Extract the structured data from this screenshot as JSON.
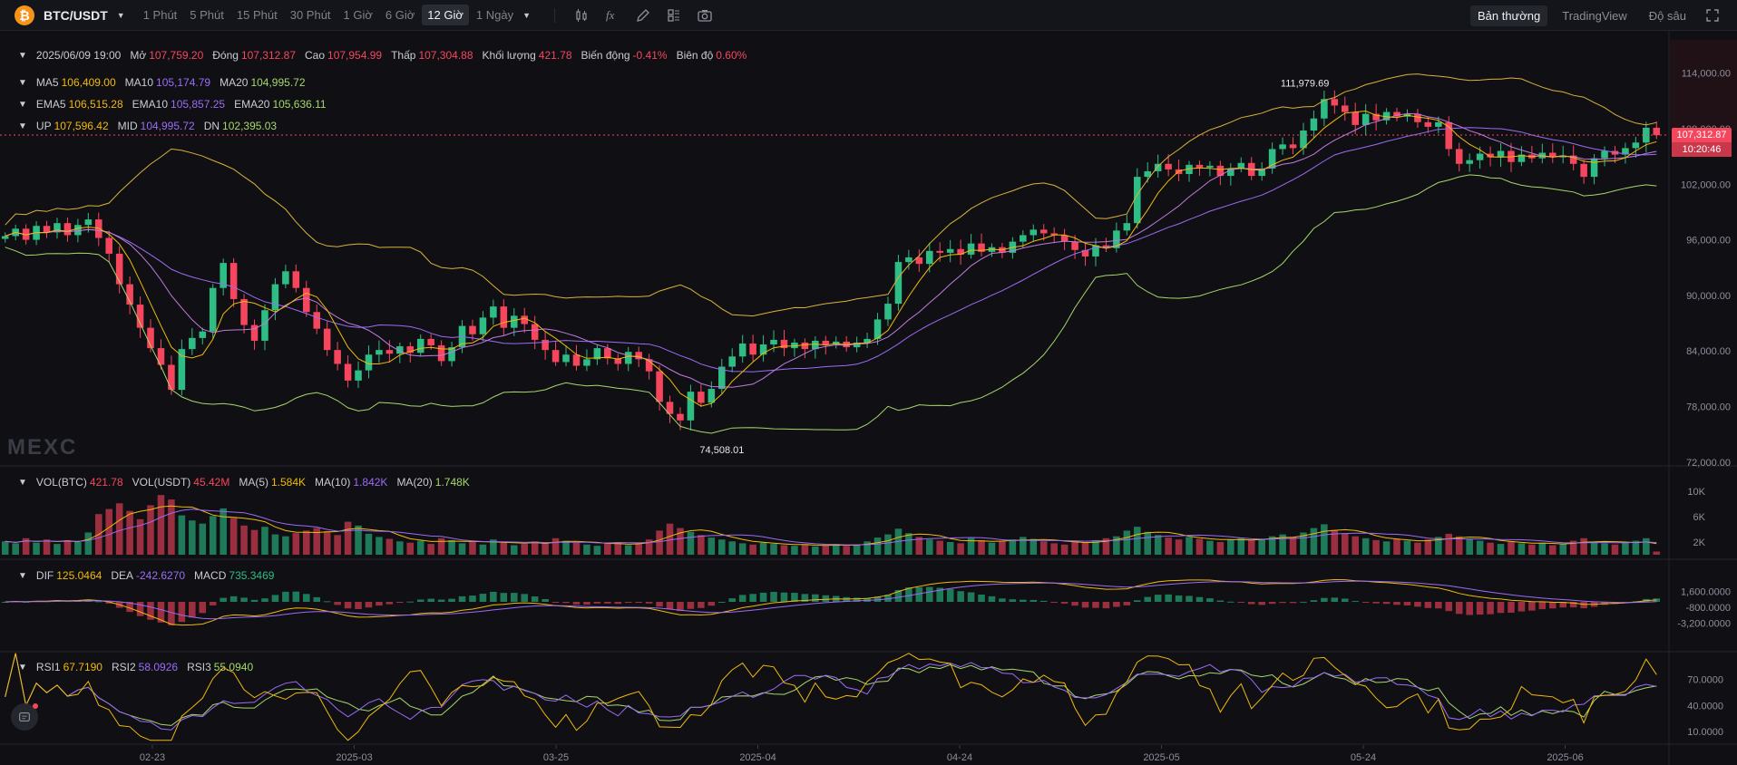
{
  "toolbar": {
    "pair": "BTC/USDT",
    "coin_icon": "bitcoin-icon",
    "intervals": [
      "1 Phút",
      "5 Phút",
      "15 Phút",
      "30 Phút",
      "1 Giờ",
      "6 Giờ",
      "12 Giờ",
      "1 Ngày"
    ],
    "active_interval": "12 Giờ",
    "tools": [
      "candle-type-icon",
      "indicator-fx-icon",
      "draw-pen-icon",
      "layout-grid-icon",
      "camera-icon"
    ],
    "view_tabs": [
      "Bản thường",
      "TradingView",
      "Độ sâu"
    ],
    "active_view": "Bản thường",
    "fullscreen_icon": "fullscreen-icon"
  },
  "ohlc": {
    "date": "2025/06/09 19:00",
    "open_label": "Mở",
    "open": "107,759.20",
    "close_label": "Đóng",
    "close": "107,312.87",
    "high_label": "Cao",
    "high": "107,954.99",
    "low_label": "Thấp",
    "low": "107,304.88",
    "volume_label": "Khối lượng",
    "volume": "421.78",
    "change_label": "Biến động",
    "change": "-0.41%",
    "amplitude_label": "Biên độ",
    "amplitude": "0.60%"
  },
  "ma": {
    "ma5_label": "MA5",
    "ma5": "106,409.00",
    "ma10_label": "MA10",
    "ma10": "105,174.79",
    "ma20_label": "MA20",
    "ma20": "104,995.72"
  },
  "ema": {
    "ema5_label": "EMA5",
    "ema5": "106,515.28",
    "ema10_label": "EMA10",
    "ema10": "105,857.25",
    "ema20_label": "EMA20",
    "ema20": "105,636.11"
  },
  "boll": {
    "up_label": "UP",
    "up": "107,596.42",
    "mid_label": "MID",
    "mid": "104,995.72",
    "dn_label": "DN",
    "dn": "102,395.03"
  },
  "vol": {
    "btc_label": "VOL(BTC)",
    "btc": "421.78",
    "usdt_label": "VOL(USDT)",
    "usdt": "45.42M",
    "ma5_label": "MA(5)",
    "ma5": "1.584K",
    "ma10_label": "MA(10)",
    "ma10": "1.842K",
    "ma20_label": "MA(20)",
    "ma20": "1.748K"
  },
  "macd": {
    "dif_label": "DIF",
    "dif": "125.0464",
    "dea_label": "DEA",
    "dea": "-242.6270",
    "macd_label": "MACD",
    "macd": "735.3469"
  },
  "rsi": {
    "rsi1_label": "RSI1",
    "rsi1": "67.7190",
    "rsi2_label": "RSI2",
    "rsi2": "58.0926",
    "rsi3_label": "RSI3",
    "rsi3": "55.0940"
  },
  "current_price": {
    "price": "107,312.87",
    "countdown": "10:20:46"
  },
  "watermark": "MEXC",
  "colors": {
    "up": "#2ebd85",
    "down": "#f6465d",
    "ma5": "#f0b90b",
    "ma10": "#9b6cf5",
    "ma20": "#a6d76b",
    "boll": "#d9b23a"
  },
  "chart_data": [
    {
      "type": "candlestick",
      "title": "BTC/USDT 12 Giờ",
      "price_axis_ticks": [
        114000,
        108000,
        102000,
        96000,
        90000,
        84000,
        78000,
        72000
      ],
      "price_axis_labels": [
        "114,000.00",
        "108,000.00",
        "102,000.00",
        "96,000.00",
        "90,000.00",
        "84,000.00",
        "78,000.00",
        "72,000.00"
      ],
      "ylim": [
        71000,
        117000
      ],
      "x_labels": [
        "02-23",
        "2025-03",
        "03-25",
        "2025-04",
        "04-24",
        "2025-05",
        "05-24",
        "2025-06"
      ],
      "annotations": [
        {
          "label": "111,979.69",
          "value": 111979.69,
          "kind": "high"
        },
        {
          "label": "74,508.01",
          "value": 74508.01,
          "kind": "low"
        }
      ],
      "close_path": [
        96400,
        97200,
        96000,
        97500,
        96800,
        97800,
        96500,
        97600,
        98200,
        96200,
        94500,
        91200,
        89000,
        86500,
        84300,
        82500,
        79800,
        84200,
        85400,
        86100,
        90800,
        93500,
        89600,
        86800,
        85100,
        88400,
        91200,
        92600,
        90800,
        88200,
        86400,
        84100,
        82600,
        80800,
        81900,
        83600,
        84100,
        83700,
        84500,
        83800,
        85300,
        84600,
        82900,
        84400,
        86700,
        85800,
        87600,
        88800,
        86500,
        87800,
        86900,
        85200,
        84100,
        82800,
        83600,
        82400,
        83100,
        84300,
        83200,
        82600,
        83900,
        83100,
        81800,
        78500,
        77200,
        76500,
        79600,
        78400,
        79900,
        82300,
        83400,
        84800,
        83600,
        84700,
        85200,
        84300,
        84900,
        84200,
        85100,
        84700,
        85000,
        84400,
        84900,
        85300,
        87400,
        89100,
        93600,
        94100,
        93400,
        94800,
        94600,
        95000,
        94400,
        95600,
        94700,
        95200,
        94600,
        95800,
        96500,
        97100,
        96700,
        96500,
        95800,
        94900,
        94200,
        95400,
        95100,
        97000,
        97800,
        102800,
        103400,
        104200,
        103600,
        103100,
        104100,
        103800,
        104000,
        102900,
        103700,
        104300,
        102900,
        103700,
        105800,
        106300,
        105900,
        107800,
        109100,
        111200,
        110500,
        109800,
        108400,
        109600,
        108900,
        109800,
        109300,
        109600,
        108700,
        108200,
        108700,
        105800,
        104200,
        104600,
        105300,
        104900,
        105600,
        104400,
        105200,
        104800,
        105400,
        104900,
        105100,
        104200,
        102800,
        104800,
        105600,
        105200,
        105900,
        106500,
        108100,
        107300
      ],
      "volume_axis_labels": [
        "10K",
        "6K",
        "2K"
      ],
      "volume": [
        2.1,
        1.8,
        2.6,
        1.9,
        2.4,
        1.7,
        2.3,
        2.0,
        3.5,
        6.4,
        7.2,
        8.1,
        6.9,
        5.6,
        7.8,
        9.4,
        8.7,
        6.2,
        5.4,
        4.9,
        6.1,
        7.3,
        5.8,
        4.6,
        3.9,
        4.4,
        3.2,
        2.9,
        3.4,
        3.8,
        4.2,
        3.7,
        3.1,
        5.2,
        4.6,
        3.3,
        2.8,
        2.5,
        2.1,
        1.9,
        2.2,
        1.7,
        2.6,
        2.3,
        1.8,
        2.0,
        1.6,
        2.4,
        1.9,
        1.5,
        1.7,
        2.1,
        1.8,
        2.6,
        2.2,
        1.9,
        1.6,
        1.4,
        1.8,
        2.0,
        1.5,
        1.9,
        2.4,
        3.8,
        4.9,
        4.2,
        3.6,
        3.1,
        2.7,
        2.4,
        2.1,
        1.8,
        1.6,
        1.9,
        1.7,
        1.5,
        1.4,
        1.6,
        1.3,
        1.5,
        1.7,
        1.4,
        1.6,
        2.1,
        2.7,
        3.2,
        4.1,
        3.4,
        2.8,
        2.4,
        2.2,
        2.0,
        1.8,
        2.6,
        2.3,
        1.9,
        2.1,
        2.4,
        2.8,
        2.5,
        2.1,
        1.8,
        1.6,
        2.2,
        1.9,
        2.3,
        2.6,
        2.9,
        3.8,
        4.4,
        3.6,
        3.1,
        2.7,
        2.4,
        2.8,
        2.5,
        2.2,
        2.0,
        2.4,
        2.7,
        2.3,
        2.5,
        2.9,
        3.2,
        2.8,
        3.5,
        4.2,
        4.8,
        3.9,
        3.3,
        2.9,
        2.6,
        2.3,
        2.1,
        2.5,
        2.2,
        1.9,
        2.4,
        2.8,
        3.3,
        2.9,
        2.5,
        2.2,
        1.9,
        1.7,
        2.1,
        1.8,
        1.6,
        1.9,
        1.5,
        1.7,
        2.2,
        2.6,
        2.1,
        1.8,
        1.6,
        1.9,
        2.2,
        2.6,
        0.5
      ],
      "macd_axis_labels": [
        "1,600.0000",
        "-800.0000",
        "-3,200.0000"
      ],
      "rsi_axis_labels": [
        "70.0000",
        "40.0000",
        "10.0000"
      ]
    }
  ]
}
